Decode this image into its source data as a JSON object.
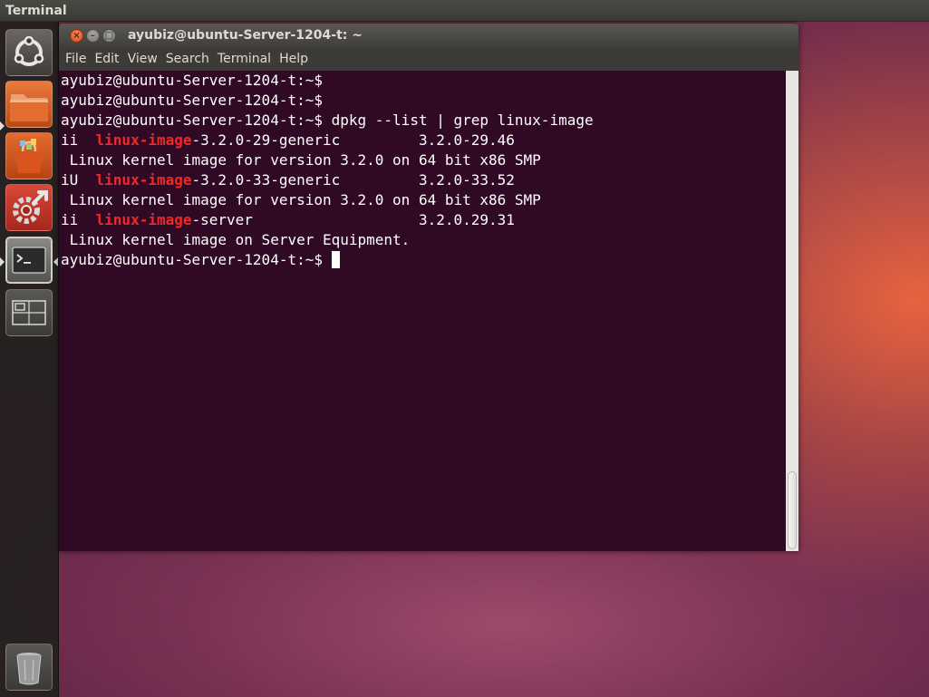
{
  "topbar": {
    "title": "Terminal"
  },
  "launcher": {
    "items": [
      {
        "name": "dash-home",
        "icon": "ubuntu-logo-icon"
      },
      {
        "name": "home-folder",
        "icon": "folder-icon"
      },
      {
        "name": "software-center",
        "icon": "shopping-bag-icon"
      },
      {
        "name": "system-settings",
        "icon": "gear-wrench-icon"
      },
      {
        "name": "terminal",
        "icon": "terminal-icon"
      },
      {
        "name": "workspace-switcher",
        "icon": "workspaces-icon"
      },
      {
        "name": "trash",
        "icon": "trash-icon"
      }
    ]
  },
  "window": {
    "title": "ayubiz@ubuntu-Server-1204-t: ~",
    "buttons": {
      "close": "×",
      "minimize": "–",
      "maximize": "□"
    },
    "menu": [
      "File",
      "Edit",
      "View",
      "Search",
      "Terminal",
      "Help"
    ]
  },
  "terminal": {
    "lines": [
      {
        "pre": "ayubiz@ubuntu-Server-1204-t:~$",
        "hl": "",
        "post": ""
      },
      {
        "pre": "ayubiz@ubuntu-Server-1204-t:~$",
        "hl": "",
        "post": ""
      },
      {
        "pre": "ayubiz@ubuntu-Server-1204-t:~$ dpkg --list | grep linux-image",
        "hl": "",
        "post": ""
      },
      {
        "pre": "ii  ",
        "hl": "linux-image",
        "post": "-3.2.0-29-generic         3.2.0-29.46"
      },
      {
        "pre": " Linux kernel image for version 3.2.0 on 64 bit x86 SMP",
        "hl": "",
        "post": ""
      },
      {
        "pre": "iU  ",
        "hl": "linux-image",
        "post": "-3.2.0-33-generic         3.2.0-33.52"
      },
      {
        "pre": " Linux kernel image for version 3.2.0 on 64 bit x86 SMP",
        "hl": "",
        "post": ""
      },
      {
        "pre": "ii  ",
        "hl": "linux-image",
        "post": "-server                   3.2.0.29.31"
      },
      {
        "pre": " Linux kernel image on Server Equipment.",
        "hl": "",
        "post": ""
      },
      {
        "pre": "ayubiz@ubuntu-Server-1204-t:~$ ",
        "hl": "",
        "post": ""
      }
    ]
  },
  "colors": {
    "terminal_bg": "#300a24",
    "highlight": "#ef2929",
    "close_button": "#e2582a"
  }
}
